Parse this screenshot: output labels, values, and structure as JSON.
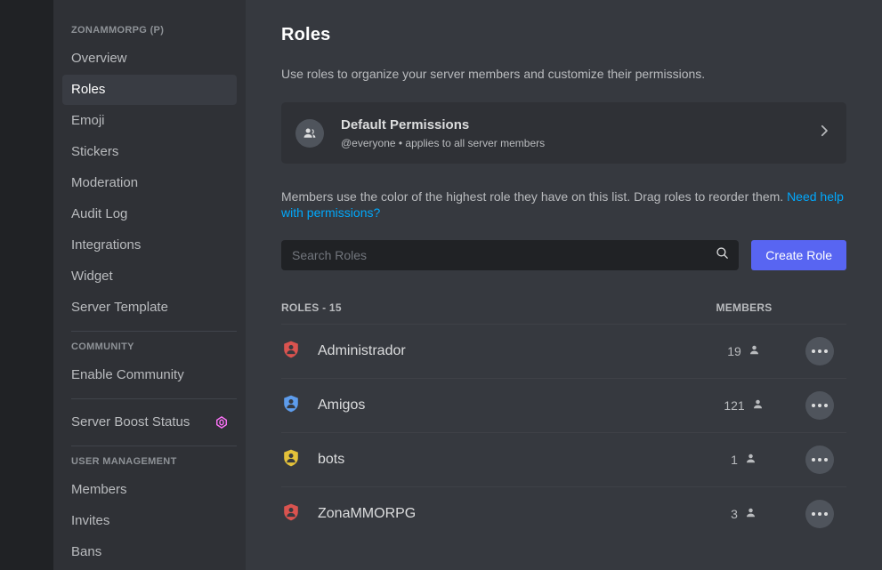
{
  "sidebar": {
    "server_header": "ZONAMMORPG (P)",
    "items": [
      {
        "label": "Overview",
        "active": false
      },
      {
        "label": "Roles",
        "active": true
      },
      {
        "label": "Emoji",
        "active": false
      },
      {
        "label": "Stickers",
        "active": false
      },
      {
        "label": "Moderation",
        "active": false
      },
      {
        "label": "Audit Log",
        "active": false
      },
      {
        "label": "Integrations",
        "active": false
      },
      {
        "label": "Widget",
        "active": false
      },
      {
        "label": "Server Template",
        "active": false
      }
    ],
    "community_header": "COMMUNITY",
    "community_items": [
      {
        "label": "Enable Community"
      }
    ],
    "boost_item": {
      "label": "Server Boost Status",
      "icon": "boost-gem-icon",
      "icon_color": "#ff73fa"
    },
    "user_management_header": "USER MANAGEMENT",
    "user_management_items": [
      {
        "label": "Members"
      },
      {
        "label": "Invites"
      },
      {
        "label": "Bans"
      }
    ]
  },
  "main": {
    "title": "Roles",
    "subtitle": "Use roles to organize your server members and customize their permissions.",
    "default_permissions": {
      "title": "Default Permissions",
      "description": "@everyone • applies to all server members",
      "avatar_icon": "people-icon",
      "chevron_icon": "chevron-right-icon"
    },
    "hint": {
      "text": "Members use the color of the highest role they have on this list. Drag roles to reorder them. ",
      "link": "Need help with permissions?"
    },
    "search": {
      "placeholder": "Search Roles",
      "value": "",
      "icon": "search-icon"
    },
    "create_button": "Create Role",
    "table": {
      "header_roles": "ROLES - 15",
      "header_members": "MEMBERS",
      "rows": [
        {
          "name": "Administrador",
          "members": "19",
          "color": "#d9534f",
          "icon": "role-shield-icon"
        },
        {
          "name": "Amigos",
          "members": "121",
          "color": "#5d9cec",
          "icon": "role-shield-icon"
        },
        {
          "name": "bots",
          "members": "1",
          "color": "#e3c13a",
          "icon": "role-shield-icon"
        },
        {
          "name": "ZonaMMORPG",
          "members": "3",
          "color": "#d9534f",
          "icon": "role-shield-icon"
        }
      ],
      "member_icon": "person-icon",
      "actions_icon": "more-options-icon"
    }
  },
  "colors": {
    "accent": "#5865f2",
    "link": "#00a8fc",
    "background": "#36393f",
    "sidebar": "#2f3136"
  }
}
